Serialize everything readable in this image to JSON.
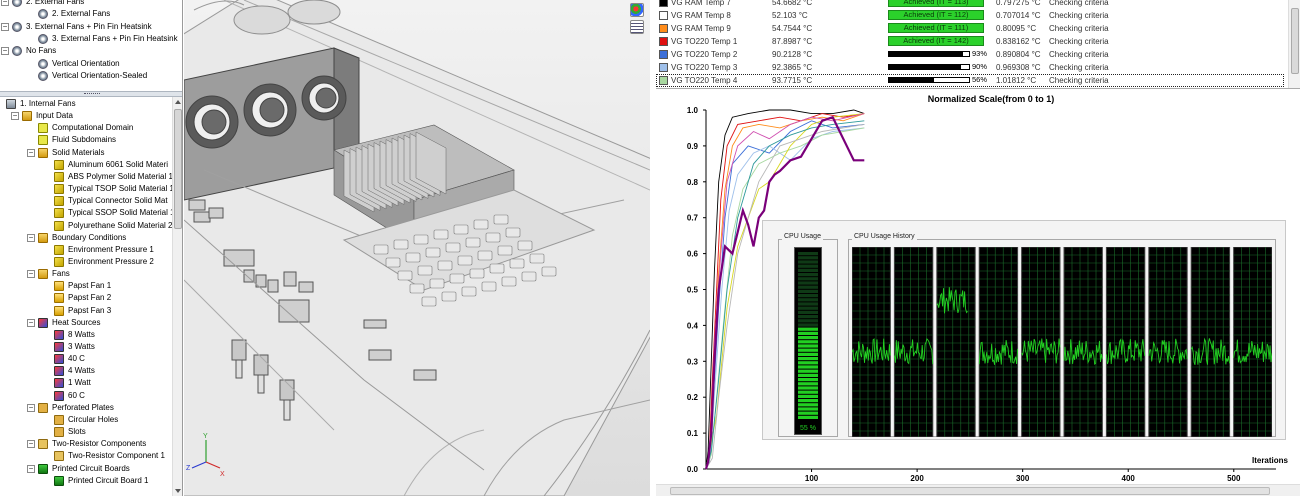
{
  "tree_top": {
    "items": [
      {
        "label": "2. External Fans",
        "level": 0,
        "icon": "config-folder-icon",
        "expander": "-"
      },
      {
        "label": "2. External Fans",
        "level": 1,
        "icon": "configuration-icon"
      },
      {
        "label": "3. External Fans + Pin Fin Heatsink",
        "level": 0,
        "icon": "config-folder-icon",
        "expander": "-"
      },
      {
        "label": "3. External Fans + Pin Fin Heatsink",
        "level": 1,
        "icon": "configuration-icon"
      },
      {
        "label": "No Fans",
        "level": 0,
        "icon": "config-folder-icon",
        "expander": "-"
      },
      {
        "label": "Vertical Orientation",
        "level": 1,
        "icon": "configuration-icon"
      },
      {
        "label": "Vertical Orientation-Sealed",
        "level": 1,
        "icon": "configuration-icon"
      }
    ]
  },
  "tree": {
    "items": [
      {
        "label": "1. Internal Fans",
        "level": 0,
        "icon": "assembly-icon"
      },
      {
        "label": "Input Data",
        "level": 1,
        "icon": "folder-icon",
        "expander": "-"
      },
      {
        "label": "Computational Domain",
        "level": 2,
        "icon": "domain-icon"
      },
      {
        "label": "Fluid Subdomains",
        "level": 2,
        "icon": "domain-icon"
      },
      {
        "label": "Solid Materials",
        "level": 2,
        "icon": "folder-icon",
        "expander": "-"
      },
      {
        "label": "Aluminum 6061 Solid Materi",
        "level": 3,
        "icon": "material-icon"
      },
      {
        "label": "ABS Polymer Solid Material 1",
        "level": 3,
        "icon": "material-icon"
      },
      {
        "label": "Typical TSOP Solid Material 1",
        "level": 3,
        "icon": "material-icon"
      },
      {
        "label": "Typical Connector Solid Mat",
        "level": 3,
        "icon": "material-icon"
      },
      {
        "label": "Typical SSOP Solid Material 1",
        "level": 3,
        "icon": "material-icon"
      },
      {
        "label": "Polyurethane Solid Material 2",
        "level": 3,
        "icon": "material-icon"
      },
      {
        "label": "Boundary Conditions",
        "level": 2,
        "icon": "folder-icon",
        "expander": "-"
      },
      {
        "label": "Environment Pressure 1",
        "level": 3,
        "icon": "boundary-icon"
      },
      {
        "label": "Environment Pressure 2",
        "level": 3,
        "icon": "boundary-icon"
      },
      {
        "label": "Fans",
        "level": 2,
        "icon": "folder-icon",
        "expander": "-"
      },
      {
        "label": "Papst Fan 1",
        "level": 3,
        "icon": "fan-icon"
      },
      {
        "label": "Papst Fan 2",
        "level": 3,
        "icon": "fan-icon"
      },
      {
        "label": "Papst Fan 3",
        "level": 3,
        "icon": "fan-icon"
      },
      {
        "label": "Heat Sources",
        "level": 2,
        "icon": "heat-folder-icon",
        "expander": "-"
      },
      {
        "label": "8 Watts",
        "level": 3,
        "icon": "heat-source-icon"
      },
      {
        "label": "3 Watts",
        "level": 3,
        "icon": "heat-source-icon"
      },
      {
        "label": "40 C",
        "level": 3,
        "icon": "heat-source-icon"
      },
      {
        "label": "4 Watts",
        "level": 3,
        "icon": "heat-source-icon"
      },
      {
        "label": "1 Watt",
        "level": 3,
        "icon": "heat-source-icon"
      },
      {
        "label": "60 C",
        "level": 3,
        "icon": "heat-source-icon"
      },
      {
        "label": "Perforated Plates",
        "level": 2,
        "icon": "plate-folder-icon",
        "expander": "-"
      },
      {
        "label": "Circular Holes",
        "level": 3,
        "icon": "plate-icon"
      },
      {
        "label": "Slots",
        "level": 3,
        "icon": "plate-icon"
      },
      {
        "label": "Two-Resistor Components",
        "level": 2,
        "icon": "resistor-folder-icon",
        "expander": "-"
      },
      {
        "label": "Two-Resistor Component 1",
        "level": 3,
        "icon": "resistor-icon"
      },
      {
        "label": "Printed Circuit Boards",
        "level": 2,
        "icon": "pcb-folder-icon",
        "expander": "-"
      },
      {
        "label": "Printed Circuit Board 1",
        "level": 3,
        "icon": "pcb-icon"
      }
    ]
  },
  "goals": {
    "rows": [
      {
        "name": "VG RAM Temp 7",
        "value": "54.6682 °C",
        "status_type": "achieved",
        "progress_text": "Achieved (IT = 113)",
        "delta": "0.797275 °C",
        "criteria": "Checking criteria",
        "color": "#000000"
      },
      {
        "name": "VG RAM Temp 8",
        "value": "52.103 °C",
        "status_type": "achieved",
        "progress_text": "Achieved (IT = 112)",
        "delta": "0.707014 °C",
        "criteria": "Checking criteria",
        "color": "#ffffff"
      },
      {
        "name": "VG RAM Temp 9",
        "value": "54.7544 °C",
        "status_type": "achieved",
        "progress_text": "Achieved (IT = 111)",
        "delta": "0.80095 °C",
        "criteria": "Checking criteria",
        "color": "#ff8c1a"
      },
      {
        "name": "VG TO220 Temp 1",
        "value": "87.8987 °C",
        "status_type": "achieved",
        "progress_text": "Achieved (IT = 142)",
        "delta": "0.838162 °C",
        "criteria": "Checking criteria",
        "color": "#e01010"
      },
      {
        "name": "VG TO220 Temp 2",
        "value": "90.2128 °C",
        "status_type": "progress",
        "progress": 0.93,
        "progress_text": "93%",
        "delta": "0.890804 °C",
        "criteria": "Checking criteria",
        "color": "#3c6fd8"
      },
      {
        "name": "VG TO220 Temp 3",
        "value": "92.3865 °C",
        "status_type": "progress",
        "progress": 0.9,
        "progress_text": "90%",
        "delta": "0.969308 °C",
        "criteria": "Checking criteria",
        "color": "#9fc0ea"
      },
      {
        "name": "VG TO220 Temp 4",
        "value": "93.7715 °C",
        "status_type": "progress",
        "progress": 0.56,
        "progress_text": "56%",
        "delta": "1.01812 °C",
        "criteria": "Checking criteria",
        "color": "#a8d8a0"
      }
    ]
  },
  "chart_data": {
    "type": "line",
    "title": "Normalized Scale(from 0 to 1)",
    "xlabel": "Iterations",
    "ylabel": "",
    "xlim": [
      0,
      540
    ],
    "ylim": [
      0,
      1.0
    ],
    "x_ticks": [
      100,
      200,
      300,
      400,
      500
    ],
    "y_ticks": [
      0.0,
      0.1,
      0.2,
      0.3,
      0.4,
      0.5,
      0.6,
      0.7,
      0.8,
      0.9,
      1.0
    ],
    "x_tick_labels": [
      "100",
      "200",
      "300",
      "400",
      "500"
    ],
    "y_tick_labels": [
      "0.0",
      "0.1",
      "0.2",
      "0.3",
      "0.4",
      "0.5",
      "0.6",
      "0.7",
      "0.8",
      "0.9",
      "1.0"
    ],
    "series": [
      {
        "color": "#000000",
        "x": [
          0,
          2,
          5,
          8,
          12,
          18,
          25,
          40,
          60,
          80,
          100,
          120,
          140,
          150
        ],
        "y": [
          0,
          0.05,
          0.3,
          0.55,
          0.8,
          0.93,
          0.98,
          0.99,
          1.0,
          1.0,
          0.99,
          0.99,
          1.0,
          0.99
        ]
      },
      {
        "color": "#e01010",
        "x": [
          0,
          3,
          6,
          10,
          14,
          20,
          30,
          50,
          70,
          90,
          110,
          130,
          150
        ],
        "y": [
          0,
          0.04,
          0.25,
          0.5,
          0.75,
          0.9,
          0.96,
          0.97,
          0.98,
          0.97,
          0.99,
          0.98,
          0.99
        ]
      },
      {
        "color": "#ff8c1a",
        "x": [
          0,
          4,
          8,
          12,
          18,
          25,
          35,
          50,
          70,
          90,
          110,
          130,
          150
        ],
        "y": [
          0,
          0.05,
          0.3,
          0.55,
          0.78,
          0.9,
          0.95,
          0.96,
          0.95,
          0.97,
          0.98,
          0.97,
          0.99
        ]
      },
      {
        "color": "#3c6fd8",
        "x": [
          0,
          3,
          7,
          12,
          18,
          25,
          40,
          60,
          80,
          100,
          120,
          150
        ],
        "y": [
          0,
          0.02,
          0.2,
          0.45,
          0.7,
          0.85,
          0.9,
          0.88,
          0.94,
          0.97,
          0.95,
          0.96
        ]
      },
      {
        "color": "#9fc0ea",
        "x": [
          0,
          4,
          9,
          15,
          22,
          30,
          45,
          60,
          80,
          100,
          120,
          150
        ],
        "y": [
          0,
          0.03,
          0.25,
          0.5,
          0.72,
          0.82,
          0.88,
          0.9,
          0.86,
          0.92,
          0.94,
          0.95
        ]
      },
      {
        "color": "#a8d8a0",
        "x": [
          0,
          5,
          10,
          18,
          25,
          35,
          50,
          70,
          90,
          110,
          130,
          150
        ],
        "y": [
          0,
          0.04,
          0.2,
          0.45,
          0.65,
          0.78,
          0.85,
          0.88,
          0.9,
          0.93,
          0.94,
          0.95
        ]
      },
      {
        "color": "#d8d820",
        "x": [
          0,
          10,
          20,
          30,
          40,
          50,
          60,
          70,
          80,
          90,
          100,
          120,
          150
        ],
        "y": [
          0,
          0.15,
          0.45,
          0.62,
          0.7,
          0.78,
          0.8,
          0.85,
          0.9,
          0.93,
          0.96,
          0.98,
          0.99
        ]
      },
      {
        "color": "#d04fb0",
        "x": [
          0,
          4,
          8,
          14,
          20,
          30,
          45,
          60,
          80,
          100,
          120,
          150
        ],
        "y": [
          0,
          0.06,
          0.35,
          0.6,
          0.8,
          0.9,
          0.94,
          0.92,
          0.96,
          0.98,
          0.97,
          0.99
        ]
      },
      {
        "color": "#2e9a9a",
        "x": [
          0,
          5,
          12,
          20,
          30,
          45,
          60,
          80,
          100,
          120,
          150
        ],
        "y": [
          0,
          0.05,
          0.25,
          0.5,
          0.7,
          0.85,
          0.9,
          0.93,
          0.95,
          0.96,
          0.97
        ]
      },
      {
        "color": "#b8b8b8",
        "x": [
          0,
          6,
          12,
          20,
          30,
          50,
          70,
          90,
          110,
          130,
          150
        ],
        "y": [
          0,
          0.03,
          0.2,
          0.4,
          0.6,
          0.8,
          0.9,
          0.92,
          0.94,
          0.95,
          0.96
        ]
      },
      {
        "color": "#7a007a",
        "width": 2.2,
        "x": [
          0,
          2,
          5,
          8,
          12,
          18,
          25,
          30,
          35,
          40,
          45,
          50,
          55,
          60,
          65,
          70,
          80,
          90,
          100,
          110,
          120,
          130,
          140,
          150
        ],
        "y": [
          0,
          0.02,
          0.1,
          0.3,
          0.5,
          0.62,
          0.6,
          0.66,
          0.72,
          0.68,
          0.62,
          0.7,
          0.72,
          0.8,
          0.82,
          0.83,
          0.86,
          0.87,
          0.92,
          0.97,
          0.98,
          0.92,
          0.86,
          0.86
        ]
      }
    ]
  },
  "cpu_gadget": {
    "usage_title": "CPU Usage",
    "history_title": "CPU Usage History",
    "usage_percent_text": "55 %",
    "usage_value": 0.55,
    "core_levels": [
      0.45,
      0.45,
      0.72,
      0.45,
      0.45,
      0.45,
      0.45,
      0.45,
      0.45,
      0.45
    ]
  },
  "colors": {
    "achieved_green": "#2bd12b",
    "cpu_green": "#22d022",
    "grid_green": "#1a6b2a"
  }
}
